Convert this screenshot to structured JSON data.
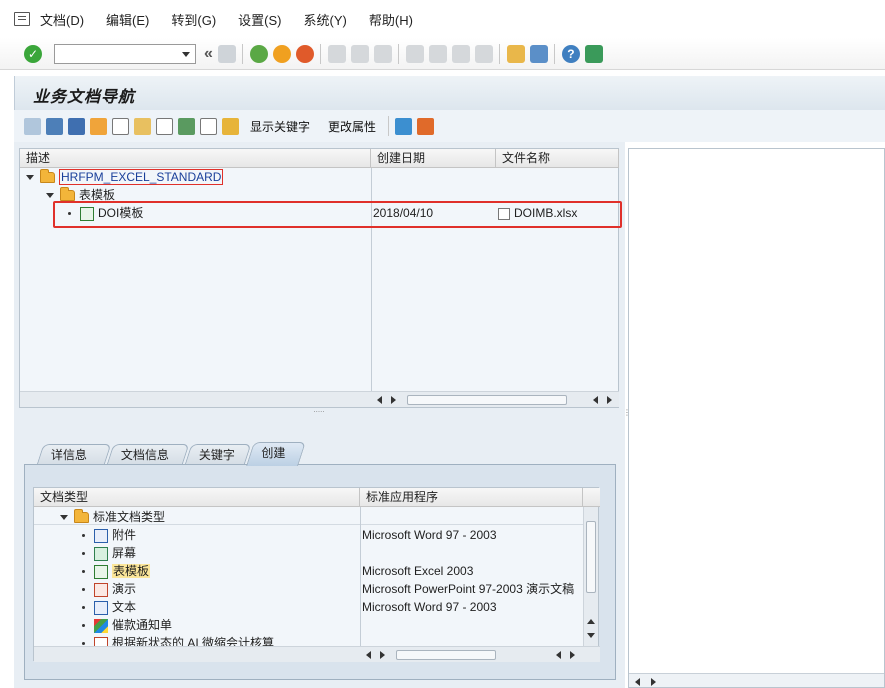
{
  "menu": {
    "items": [
      "文档(D)",
      "编辑(E)",
      "转到(G)",
      "设置(S)",
      "系统(Y)",
      "帮助(H)"
    ]
  },
  "toolbar": {
    "command_field_value": ""
  },
  "page": {
    "title": "业务文档导航"
  },
  "app_toolbar": {
    "show_keywords": "显示关键字",
    "change_attributes": "更改属性"
  },
  "doc_tree": {
    "columns": [
      "描述",
      "创建日期",
      "文件名称"
    ],
    "root": "HRFPM_EXCEL_STANDARD",
    "folder": "表模板",
    "item": {
      "description": "DOI模板",
      "created": "2018/04/10",
      "filename": "DOIMB.xlsx"
    }
  },
  "tabs": [
    "详信息",
    "文档信息",
    "关键字",
    "创建"
  ],
  "active_tab": "创建",
  "type_tree": {
    "columns": [
      "文档类型",
      "标准应用程序"
    ],
    "root": "标准文档类型",
    "items": [
      {
        "label": "附件",
        "app": "Microsoft Word 97 - 2003"
      },
      {
        "label": "屏幕",
        "app": ""
      },
      {
        "label": "表模板",
        "app": "Microsoft Excel 2003"
      },
      {
        "label": "演示",
        "app": "Microsoft PowerPoint 97-2003 演示文稿"
      },
      {
        "label": "文本",
        "app": "Microsoft Word 97 - 2003"
      },
      {
        "label": "催款通知单",
        "app": ""
      },
      {
        "label": "根据新状态的 AI 微缩会计核算",
        "app": ""
      }
    ]
  },
  "colors": {
    "highlight": "#e0302a",
    "selected": "#fbe69a",
    "folder": "#f3b53a"
  }
}
